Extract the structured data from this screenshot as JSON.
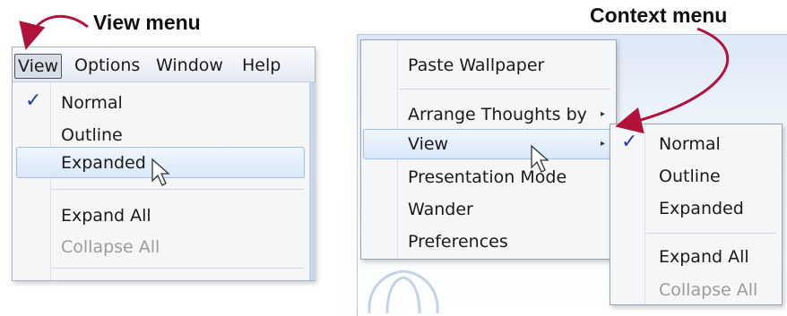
{
  "callouts": {
    "view_menu": "View menu",
    "context_menu": "Context menu"
  },
  "menubar": {
    "items": [
      "View",
      "Options",
      "Window",
      "Help"
    ]
  },
  "view_menu": {
    "check_glyph": "✓",
    "items": [
      "Normal",
      "Outline",
      "Expanded",
      "Expand All",
      "Collapse All"
    ],
    "checked": "Normal",
    "highlighted": "Expanded",
    "disabled": [
      "Collapse All"
    ]
  },
  "context_menu": {
    "items": [
      "Paste Wallpaper",
      "Arrange Thoughts by",
      "View",
      "Presentation Mode",
      "Wander",
      "Preferences"
    ],
    "highlighted": "View",
    "submenu_indicator": "▸"
  },
  "view_submenu": {
    "check_glyph": "✓",
    "items": [
      "Normal",
      "Outline",
      "Expanded",
      "Expand All",
      "Collapse All"
    ],
    "checked": "Normal",
    "disabled": [
      "Collapse All"
    ]
  },
  "colors": {
    "arrow": "#b0123a",
    "checkmark": "#2a3aa8",
    "highlight_border": "#9ec1e6"
  },
  "icons": [
    "check-icon",
    "submenu-arrow-icon",
    "mouse-cursor-icon",
    "callout-arrow-icon"
  ]
}
